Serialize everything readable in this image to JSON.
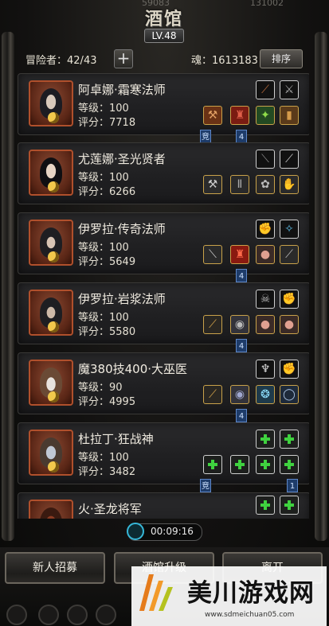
{
  "header": {
    "title": "酒馆",
    "level": "LV.48",
    "ghost_left": "59083",
    "ghost_right": "131002",
    "adventurers_label": "冒险者：",
    "adventurers_value": "42/43",
    "add_symbol": "+",
    "soul_label": "魂：",
    "soul_value": "1613183",
    "sort_label": "排序"
  },
  "labels": {
    "level": "等级：",
    "score": "评分："
  },
  "heroes": [
    {
      "name": "阿卓娜·霜寒法师",
      "level": "100",
      "score": "7718",
      "tags": [
        "竞",
        "4"
      ],
      "skills": [
        "staff-icon",
        "sword-icon"
      ],
      "equips": [
        "hammer-icon",
        "armor-icon",
        "amulet-icon",
        "boots-icon"
      ]
    },
    {
      "name": "尤莲娜·圣光贤者",
      "level": "100",
      "score": "6266",
      "tags": [],
      "skills": [
        "dagger-icon",
        "sword-icon"
      ],
      "equips": [
        "mace-icon",
        "armor-icon",
        "helmet-icon",
        "glove-icon"
      ]
    },
    {
      "name": "伊罗拉·传奇法师",
      "level": "100",
      "score": "5649",
      "tags": [
        "4"
      ],
      "skills": [
        "fist-icon",
        "aura-icon"
      ],
      "equips": [
        "wand-icon",
        "robe-icon",
        "orb-icon",
        "rake-icon"
      ]
    },
    {
      "name": "伊罗拉·岩浆法师",
      "level": "100",
      "score": "5580",
      "tags": [
        "4"
      ],
      "skills": [
        "skull-icon",
        "fist-icon"
      ],
      "equips": [
        "rod-icon",
        "pauldron-icon",
        "orb-icon",
        "orb-icon"
      ]
    },
    {
      "name": "魔380技400·大巫医",
      "level": "90",
      "score": "4995",
      "tags": [
        "4"
      ],
      "skills": [
        "totem-icon",
        "fist-icon"
      ],
      "equips": [
        "rod-icon",
        "pauldron-icon",
        "gem-icon",
        "ring-icon"
      ]
    },
    {
      "name": "杜拉丁·狂战神",
      "level": "100",
      "score": "3482",
      "tags": [
        "竞",
        "1"
      ],
      "skills": [
        "plus",
        "plus"
      ],
      "equips": [
        "sword-plus",
        "armor-plus",
        "plus",
        "plus"
      ]
    },
    {
      "name": "火·圣龙将军",
      "level": "",
      "score": "",
      "tags": [],
      "skills": [
        "plus",
        "plus"
      ],
      "equips": []
    }
  ],
  "timer": "00:09:16",
  "buttons": {
    "recruit": "新人招募",
    "upgrade": "酒馆升级",
    "leave": "离开"
  },
  "watermark": {
    "text": "美川游戏网",
    "url": "www.sdmeichuan05.com"
  },
  "colors": {
    "portrait_border": "#b0502c",
    "add_green": "#3fd23f",
    "tag_blue": "#1e3c6a",
    "timer_ring": "#36b7d8"
  }
}
